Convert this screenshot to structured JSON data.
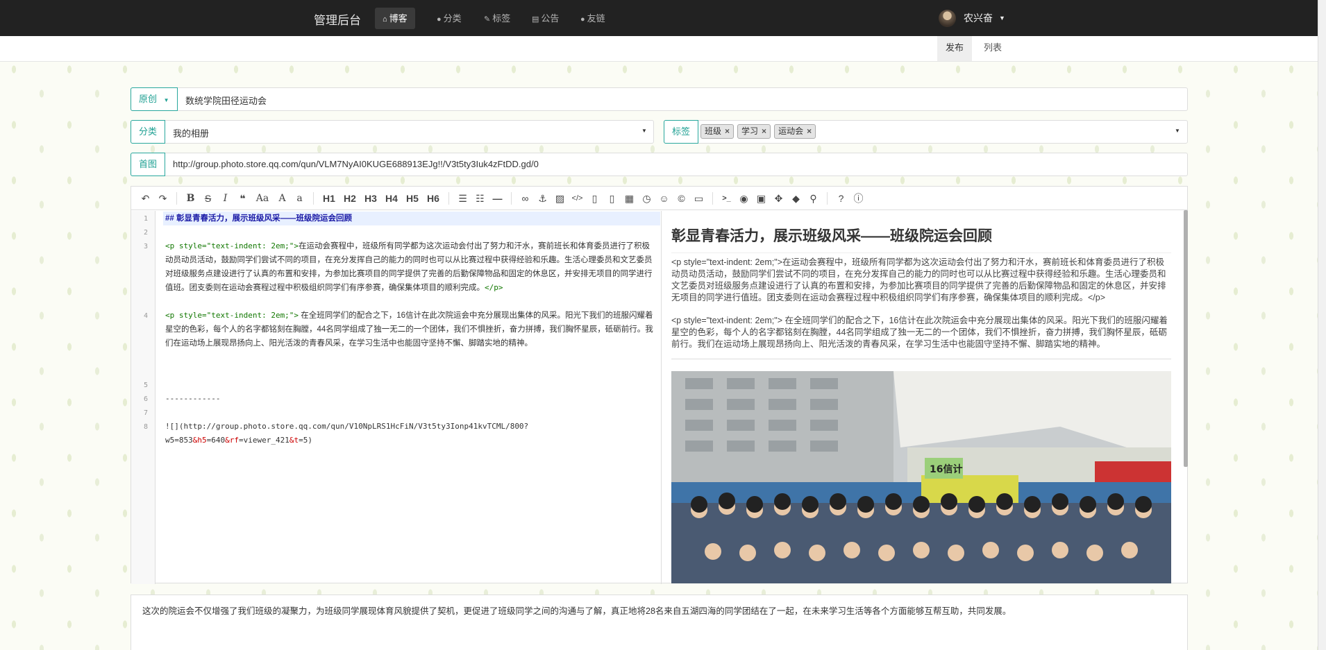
{
  "nav": {
    "brand": "管理后台",
    "items": [
      {
        "label": "博客",
        "icon": "home-icon",
        "glyph": "⌂"
      },
      {
        "label": "分类",
        "icon": "map-pin-icon",
        "glyph": "●"
      },
      {
        "label": "标签",
        "icon": "wrench-icon",
        "glyph": "✎"
      },
      {
        "label": "公告",
        "icon": "bank-icon",
        "glyph": "▤"
      },
      {
        "label": "友链",
        "icon": "apple-icon",
        "glyph": "●"
      }
    ],
    "user": "农兴奋"
  },
  "subtabs": [
    "发布",
    "列表"
  ],
  "form": {
    "type_label": "原创",
    "title": "数统学院田径运动会",
    "category_label": "分类",
    "category_value": "我的相册",
    "tags_label": "标签",
    "tags": [
      "班级",
      "学习",
      "运动会"
    ],
    "cover_label": "首图",
    "cover_url": "http://group.photo.store.qq.com/qun/VLM7NyAI0KUGE688913EJg!!/V3t5ty3Iuk4zFtDD.gd/0"
  },
  "toolbar": {
    "headings": [
      "H1",
      "H2",
      "H3",
      "H4",
      "H5",
      "H6"
    ]
  },
  "editor": {
    "line_numbers": [
      "1",
      "2",
      "3",
      "4",
      "5",
      "6",
      "7",
      "8"
    ],
    "line1": "## 彰显青春活力，展示班级风采——班级院运会回顾",
    "line3_open": "<p style=\"text-indent: 2em;\">",
    "line3_text": "在运动会赛程中，班级所有同学都为这次运动会付出了努力和汗水，赛前班长和体育委员进行了积极动员动员活动，鼓励同学们尝试不同的项目，在充分发挥自己的能力的同时也可以从比赛过程中获得经验和乐趣。生活心理委员和文艺委员对班级服务点建设进行了认真的布置和安排，为参加比赛项目的同学提供了完善的后勤保障物品和固定的休息区，并安排无项目的同学进行值班。团支委则在运动会赛程过程中积极组织同学们有序参赛，确保集体项目的顺利完成。",
    "line3_close": "</p>",
    "line4_open": "<p style=\"text-indent: 2em;\">",
    "line4_text": " 在全班同学们的配合之下，16信计在此次院运会中充分展现出集体的风采。阳光下我们的班服闪耀着星空的色彩，每个人的名字都铭刻在胸膛，44名同学组成了独一无二的一个团体，我们不惧挫折，奋力拼搏，我们胸怀星辰，砥砺前行。我们在运动场上展现昂扬向上、阳光活泼的青春风采，在学习生活中也能固守坚持不懈、脚踏实地的精神。",
    "line6": "------------",
    "line8_a": "![](http://group.photo.store.qq.com/qun/V10NpLRS1HcFiN/V3t5ty3Ionp41kvTCML/800?",
    "line8_b1": "w5=853",
    "line8_amp1": "&h5",
    "line8_b2": "=640",
    "line8_amp2": "&rf",
    "line8_b3": "=viewer_421",
    "line8_amp3": "&t",
    "line8_b4": "=5)"
  },
  "preview": {
    "heading": "彰显青春活力，展示班级风采——班级院运会回顾",
    "p1": "<p style=\"text-indent: 2em;\">在运动会赛程中，班级所有同学都为这次运动会付出了努力和汗水，赛前班长和体育委员进行了积极动员动员活动，鼓励同学们尝试不同的项目，在充分发挥自己的能力的同时也可以从比赛过程中获得经验和乐趣。生活心理委员和文艺委员对班级服务点建设进行了认真的布置和安排，为参加比赛项目的同学提供了完善的后勤保障物品和固定的休息区，并安排无项目的同学进行值班。团支委则在运动会赛程过程中积极组织同学们有序参赛，确保集体项目的顺利完成。</p>",
    "p2": "<p style=\"text-indent: 2em;\"> 在全班同学们的配合之下，16信计在此次院运会中充分展现出集体的风采。阳光下我们的班服闪耀着星空的色彩，每个人的名字都铭刻在胸膛，44名同学组成了独一无二的一个团体，我们不惧挫折，奋力拼搏，我们胸怀星辰，砥砺前行。我们在运动场上展现昂扬向上、阳光活泼的青春风采，在学习生活中也能固守坚持不懈、脚踏实地的精神。",
    "sign": "16信计"
  },
  "summary": "这次的院运会不仅增强了我们班级的凝聚力，为班级同学展现体育风貌提供了契机，更促进了班级同学之间的沟通与了解，真正地将28名来自五湖四海的同学团结在了一起，在未来学习生活等各个方面能够互帮互助，共同发展。"
}
